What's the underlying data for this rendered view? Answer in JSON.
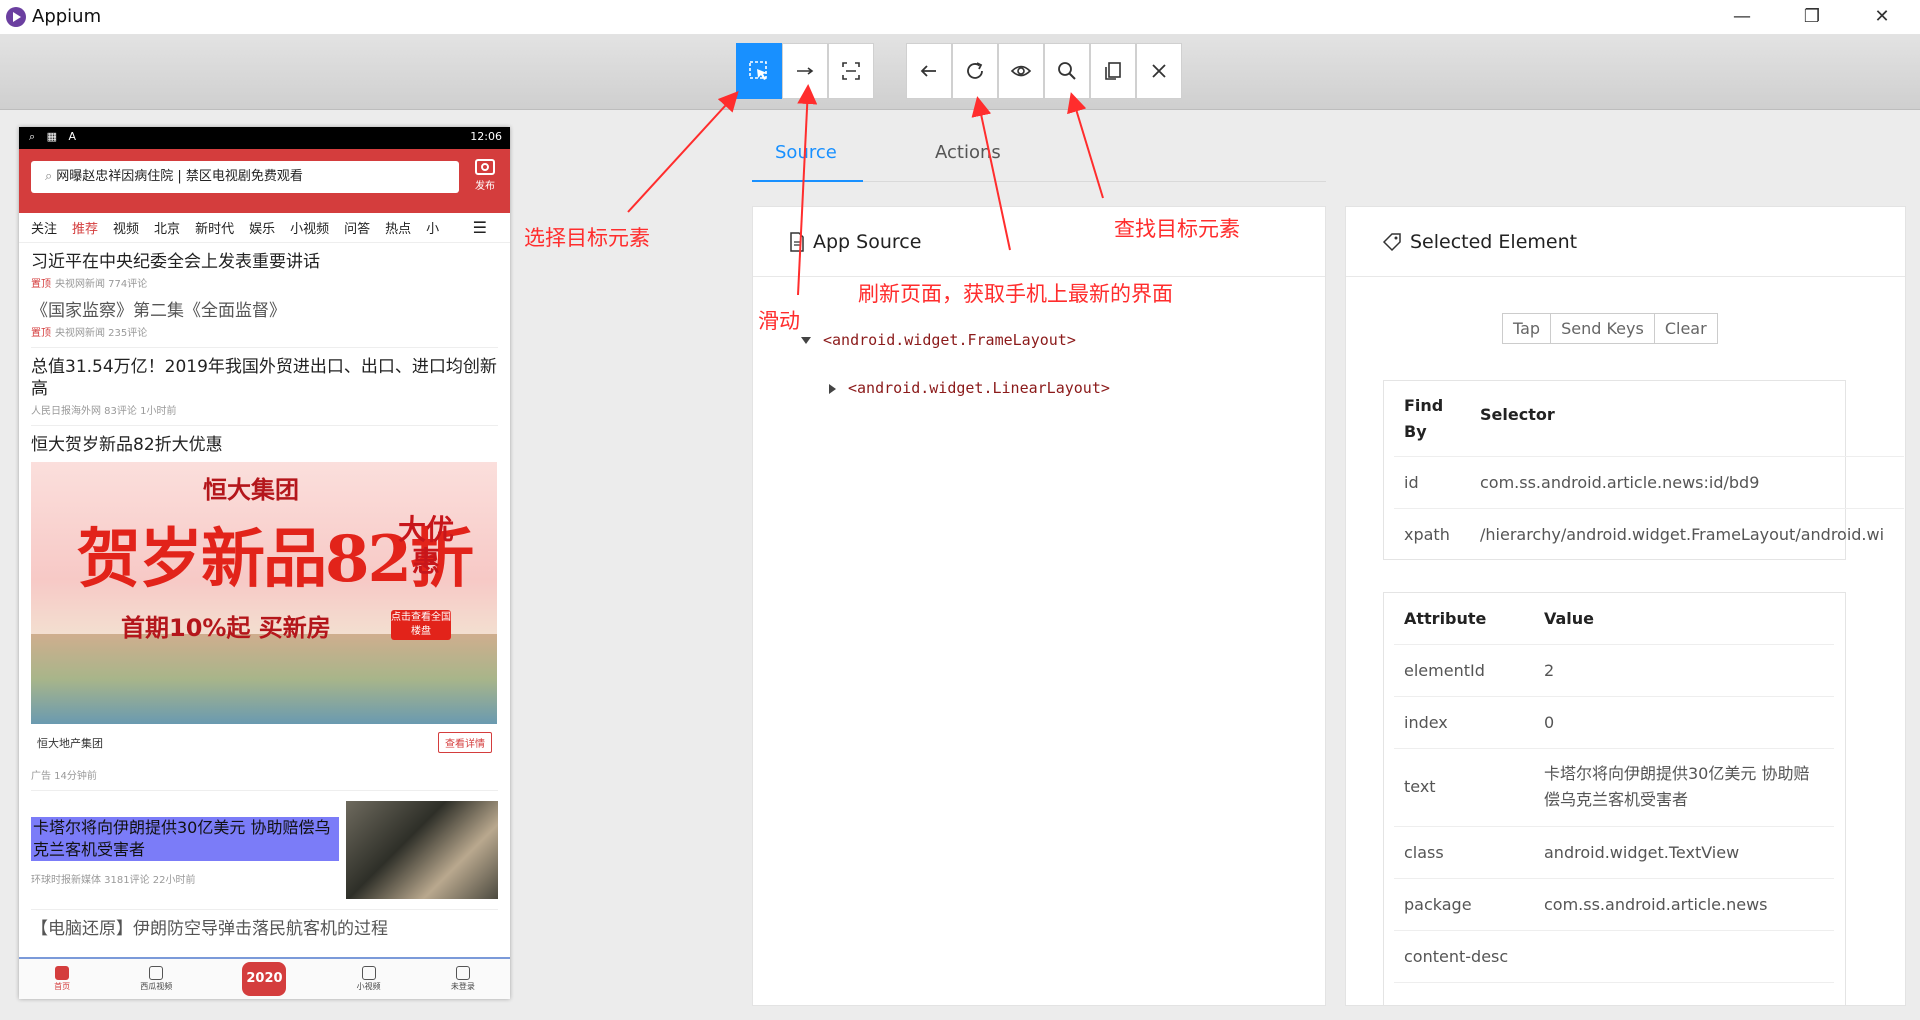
{
  "app": {
    "title": "Appium"
  },
  "window_controls": {
    "minimize": "—",
    "restore": "❐",
    "close": "✕"
  },
  "toolbar": {
    "buttons": [
      "select-element",
      "swipe",
      "tap-by-coordinates",
      "back",
      "refresh",
      "toggle-visibility",
      "search",
      "copy-xml",
      "quit"
    ],
    "active": "select-element",
    "accent": "#1890ff"
  },
  "phone": {
    "status_time": "12:06",
    "status_left": "⌕ ▦ A",
    "search_placeholder": "网曝赵忠祥因病住院 | 禁区电视剧免费观看",
    "camera_label": "发布",
    "nav_tabs": [
      "关注",
      "推荐",
      "视频",
      "北京",
      "新时代",
      "娱乐",
      "小视频",
      "问答",
      "热点",
      "小"
    ],
    "active_tab": "推荐",
    "items": [
      {
        "title": "习近平在中央纪委全会上发表重要讲话",
        "tag": "置顶",
        "meta": "央视网新闻 774评论"
      },
      {
        "title": "《国家监察》第二集《全面监督》",
        "tag": "置顶",
        "meta": "央视网新闻 235评论"
      },
      {
        "title": "总值31.54万亿！2019年我国外贸进出口、出口、进口均创新高",
        "meta": "人民日报海外网 83评论 1小时前"
      }
    ],
    "ad": {
      "title": "恒大贺岁新品82折大优惠",
      "brand": "恒大集团",
      "big": "贺岁新品82折",
      "side": "大优惠",
      "sub": "首期10%起 买新房",
      "btn": "点击查看全国楼盘",
      "company": "恒大地产集团",
      "detail": "查看详情",
      "meta": "广告 14分钟前"
    },
    "highlight": {
      "title": "卡塔尔将向伊朗提供30亿美元 协助赔偿乌克兰客机受害者",
      "meta": "环球时报新媒体 3181评论 22小时前"
    },
    "last": {
      "title": "【电脑还原】伊朗防空导弹击落民航客机的过程"
    },
    "bottom_nav": [
      "首页",
      "西瓜视频",
      "2020",
      "小视频",
      "未登录"
    ]
  },
  "tabs": {
    "source": "Source",
    "actions": "Actions"
  },
  "source_panel": {
    "title": "App Source",
    "nodes": [
      "<android.widget.FrameLayout>",
      "<android.widget.LinearLayout>"
    ]
  },
  "selected_panel": {
    "title": "Selected Element",
    "buttons": [
      "Tap",
      "Send Keys",
      "Clear"
    ],
    "find_by_header": [
      "Find By",
      "Selector"
    ],
    "find_by": [
      {
        "k": "id",
        "v": "com.ss.android.article.news:id/bd9"
      },
      {
        "k": "xpath",
        "v": "/hierarchy/android.widget.FrameLayout/android.wi"
      }
    ],
    "attr_header": [
      "Attribute",
      "Value"
    ],
    "attrs": [
      {
        "k": "elementId",
        "v": "2"
      },
      {
        "k": "index",
        "v": "0"
      },
      {
        "k": "text",
        "v": "卡塔尔将向伊朗提供30亿美元 协助赔偿乌克兰客机受害者"
      },
      {
        "k": "class",
        "v": "android.widget.TextView"
      },
      {
        "k": "package",
        "v": "com.ss.android.article.news"
      },
      {
        "k": "content-desc",
        "v": ""
      }
    ]
  },
  "annotations": {
    "select": "选择目标元素",
    "swipe": "滑动",
    "refresh": "刷新页面，获取手机上最新的界面",
    "search": "查找目标元素",
    "color": "#ff2d2d"
  }
}
